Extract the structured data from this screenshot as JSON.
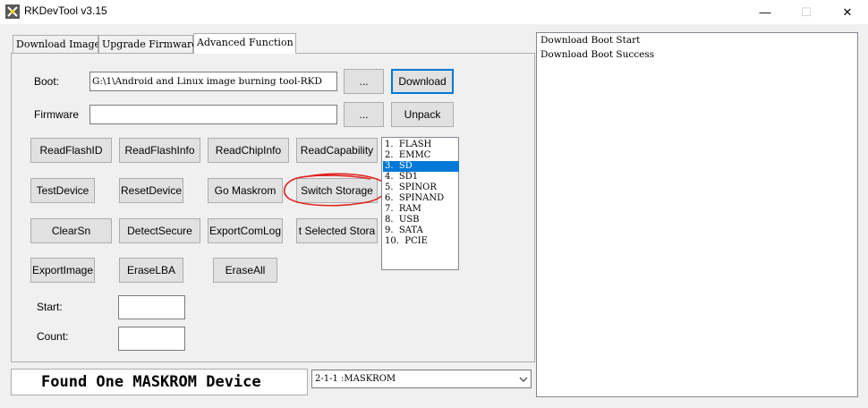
{
  "window": {
    "title": "RKDevTool v3.15",
    "controls": {
      "minimize": "—",
      "maximize": "☐",
      "close": "✕"
    }
  },
  "tabs": [
    {
      "label": "Download Image",
      "active": false
    },
    {
      "label": "Upgrade Firmware",
      "active": false
    },
    {
      "label": "Advanced Function",
      "active": true
    }
  ],
  "advanced": {
    "boot": {
      "label": "Boot:",
      "value": "G:\\1\\Android and Linux image burning tool-RKD",
      "browse_label": "...",
      "action_label": "Download"
    },
    "firmware": {
      "label": "Firmware",
      "value": "",
      "browse_label": "...",
      "action_label": "Unpack"
    },
    "buttons": [
      "ReadFlashID",
      "ReadFlashInfo",
      "ReadChipInfo",
      "ReadCapability",
      "TestDevice",
      "ResetDevice",
      "Go Maskrom",
      "Switch Storage",
      "ClearSn",
      "DetectSecure",
      "ExportComLog",
      "t Selected Stora",
      "ExportImage",
      "EraseLBA",
      "EraseAll"
    ],
    "storage_list": {
      "items": [
        "1.  FLASH",
        "2.  EMMC",
        "3.  SD",
        "4.  SD1",
        "5.  SPINOR",
        "6.  SPINAND",
        "7.  RAM",
        "8.  USB",
        "9.  SATA",
        "10.  PCIE"
      ],
      "selected_index": 2
    },
    "start": {
      "label": "Start:",
      "value": ""
    },
    "count": {
      "label": "Count:",
      "value": ""
    }
  },
  "status": {
    "message": "Found One MASKROM Device",
    "device_selected": "2-1-1 :MASKROM"
  },
  "log": {
    "lines": [
      "Download Boot Start",
      "Download Boot Success"
    ]
  },
  "colors": {
    "selection": "#0078d7",
    "annotation": "#e0201c"
  }
}
